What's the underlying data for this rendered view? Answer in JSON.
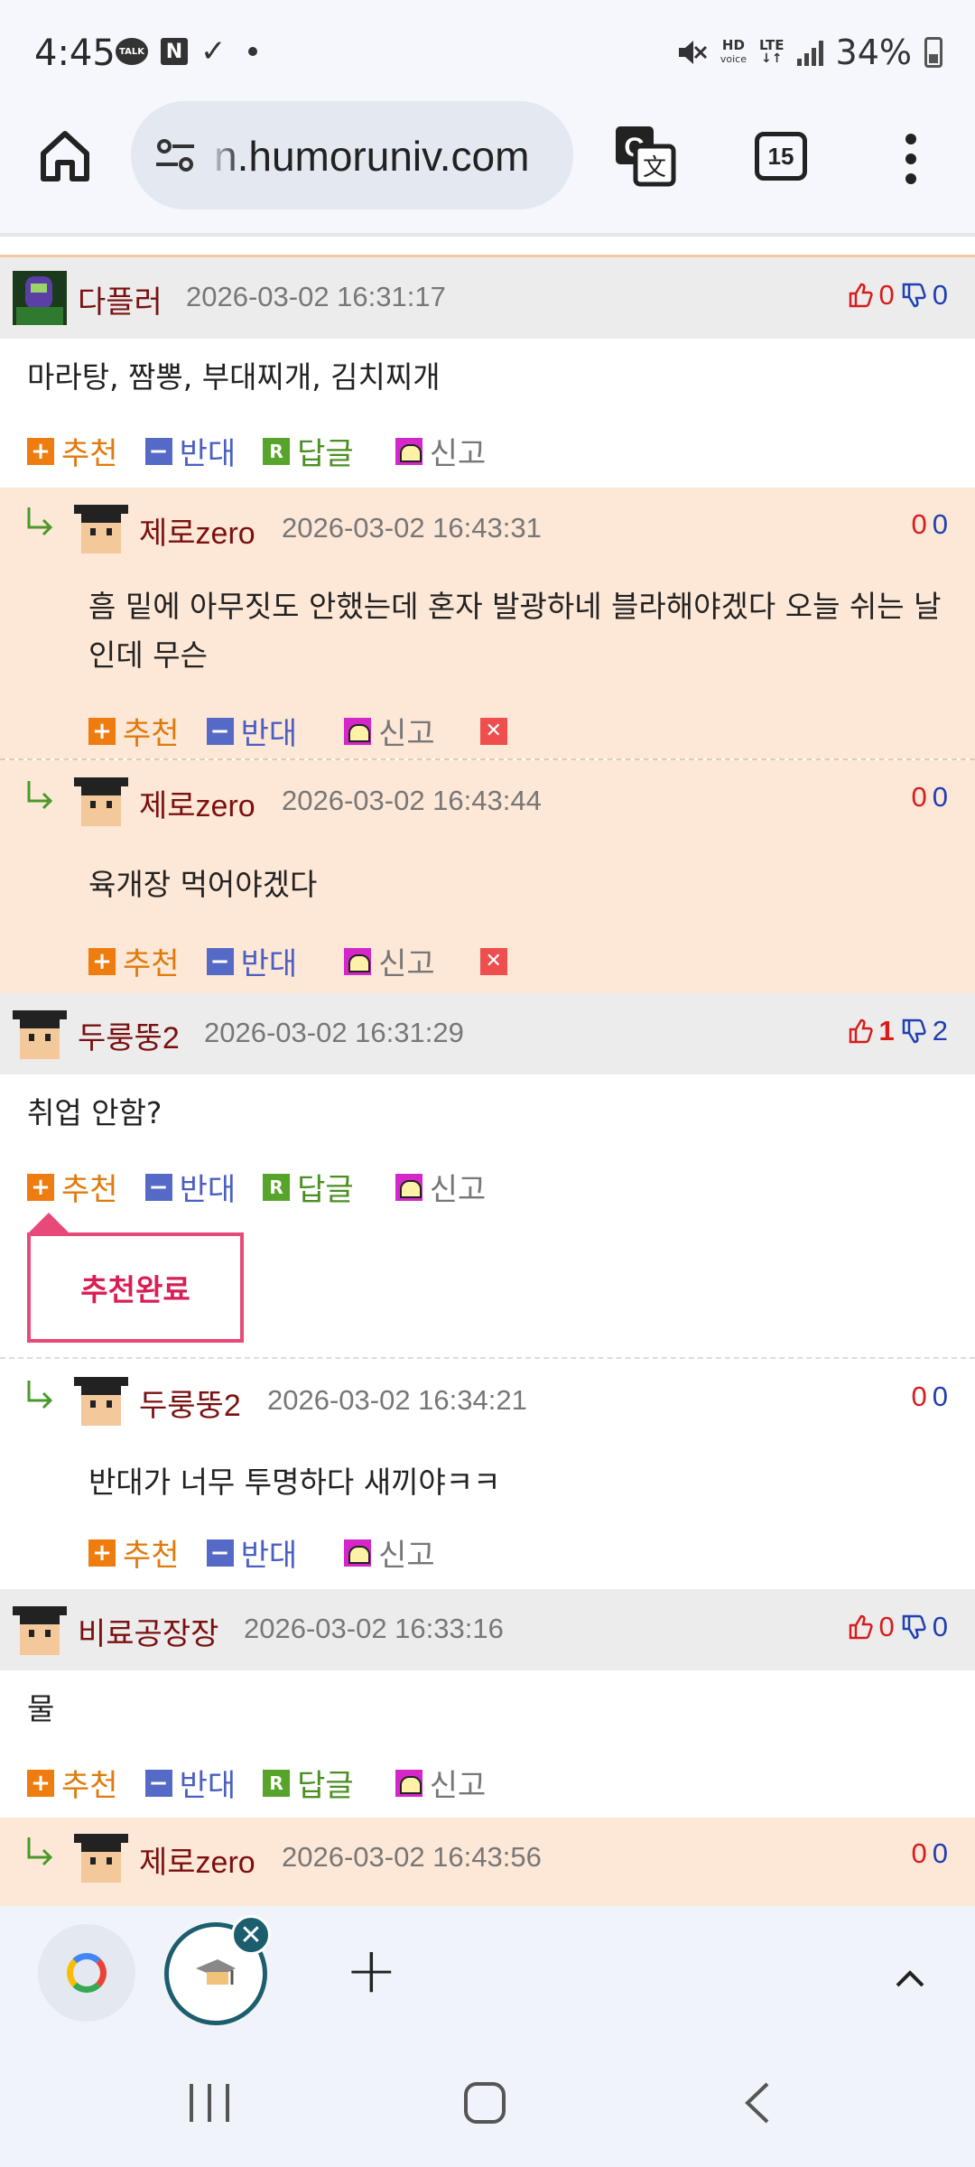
{
  "status_bar": {
    "time": "4:45",
    "talk_label": "TALK",
    "n_label": "N",
    "hd_label": "HD",
    "voice_label": "voice",
    "lte_label": "LTE",
    "battery": "34%"
  },
  "browser": {
    "url": "n.humoruniv.com",
    "tab_count": "15"
  },
  "comments": [
    {
      "author": "다플러",
      "date": "2026-03-02 16:31:17",
      "up": "0",
      "down": "0",
      "text": "마라탕, 짬뽕, 부대찌개, 김치찌개",
      "replies": [
        {
          "author": "제로zero",
          "date": "2026-03-02 16:43:31",
          "up": "0",
          "down": "0",
          "text": "흠 밑에 아무짓도 안했는데 혼자 발광하네 블라해야겠다 오늘 쉬는 날인데 무슨"
        },
        {
          "author": "제로zero",
          "date": "2026-03-02 16:43:44",
          "up": "0",
          "down": "0",
          "text": "육개장 먹어야겠다"
        }
      ]
    },
    {
      "author": "두룽뚱2",
      "date": "2026-03-02 16:31:29",
      "up": "1",
      "down": "2",
      "text": "취업 안함?",
      "replies": [
        {
          "author": "두룽뚱2",
          "date": "2026-03-02 16:34:21",
          "up": "0",
          "down": "0",
          "text": "반대가 너무 투명하다 새끼야ㅋㅋ"
        }
      ]
    },
    {
      "author": "비료공장장",
      "date": "2026-03-02 16:33:16",
      "up": "0",
      "down": "0",
      "text": "물",
      "replies": [
        {
          "author": "제로zero",
          "date": "2026-03-02 16:43:56",
          "up": "0",
          "down": "0"
        }
      ]
    }
  ],
  "actions": {
    "recommend": "추천",
    "oppose": "반대",
    "reply": "답글",
    "report": "신고",
    "reply_icon": "R"
  },
  "tooltip": "추천완료",
  "icons": {
    "home": "home-icon",
    "tune": "tune-icon",
    "translate": "translate-icon",
    "menu": "more-vert-icon",
    "thumb_up": "thumb-up-icon",
    "thumb_down": "thumb-down-icon",
    "reply_arrow": "reply-arrow-icon",
    "google": "google-icon",
    "close": "close-icon",
    "add": "add-icon",
    "chevron_up": "chevron-up-icon",
    "nav_recents": "recents-icon",
    "nav_home": "nav-home-icon",
    "nav_back": "back-icon"
  },
  "colors": {
    "nick": "#7a1010",
    "reply_bg": "#fde7d6",
    "head_bg": "#ececec",
    "tooltip": "#e74a78",
    "accent_recommend": "#ee7c0e",
    "accent_oppose": "#5569c6"
  }
}
